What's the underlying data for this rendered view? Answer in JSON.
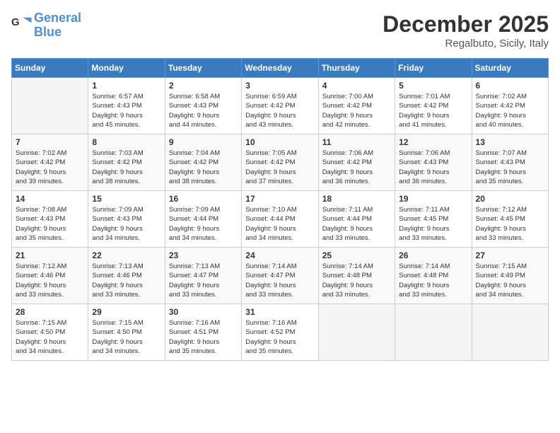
{
  "logo": {
    "line1": "General",
    "line2": "Blue"
  },
  "title": "December 2025",
  "location": "Regalbuto, Sicily, Italy",
  "days_of_week": [
    "Sunday",
    "Monday",
    "Tuesday",
    "Wednesday",
    "Thursday",
    "Friday",
    "Saturday"
  ],
  "weeks": [
    [
      {
        "day": "",
        "info": ""
      },
      {
        "day": "1",
        "info": "Sunrise: 6:57 AM\nSunset: 4:43 PM\nDaylight: 9 hours\nand 45 minutes."
      },
      {
        "day": "2",
        "info": "Sunrise: 6:58 AM\nSunset: 4:43 PM\nDaylight: 9 hours\nand 44 minutes."
      },
      {
        "day": "3",
        "info": "Sunrise: 6:59 AM\nSunset: 4:42 PM\nDaylight: 9 hours\nand 43 minutes."
      },
      {
        "day": "4",
        "info": "Sunrise: 7:00 AM\nSunset: 4:42 PM\nDaylight: 9 hours\nand 42 minutes."
      },
      {
        "day": "5",
        "info": "Sunrise: 7:01 AM\nSunset: 4:42 PM\nDaylight: 9 hours\nand 41 minutes."
      },
      {
        "day": "6",
        "info": "Sunrise: 7:02 AM\nSunset: 4:42 PM\nDaylight: 9 hours\nand 40 minutes."
      }
    ],
    [
      {
        "day": "7",
        "info": "Sunrise: 7:02 AM\nSunset: 4:42 PM\nDaylight: 9 hours\nand 39 minutes."
      },
      {
        "day": "8",
        "info": "Sunrise: 7:03 AM\nSunset: 4:42 PM\nDaylight: 9 hours\nand 38 minutes."
      },
      {
        "day": "9",
        "info": "Sunrise: 7:04 AM\nSunset: 4:42 PM\nDaylight: 9 hours\nand 38 minutes."
      },
      {
        "day": "10",
        "info": "Sunrise: 7:05 AM\nSunset: 4:42 PM\nDaylight: 9 hours\nand 37 minutes."
      },
      {
        "day": "11",
        "info": "Sunrise: 7:06 AM\nSunset: 4:42 PM\nDaylight: 9 hours\nand 36 minutes."
      },
      {
        "day": "12",
        "info": "Sunrise: 7:06 AM\nSunset: 4:43 PM\nDaylight: 9 hours\nand 36 minutes."
      },
      {
        "day": "13",
        "info": "Sunrise: 7:07 AM\nSunset: 4:43 PM\nDaylight: 9 hours\nand 35 minutes."
      }
    ],
    [
      {
        "day": "14",
        "info": "Sunrise: 7:08 AM\nSunset: 4:43 PM\nDaylight: 9 hours\nand 35 minutes."
      },
      {
        "day": "15",
        "info": "Sunrise: 7:09 AM\nSunset: 4:43 PM\nDaylight: 9 hours\nand 34 minutes."
      },
      {
        "day": "16",
        "info": "Sunrise: 7:09 AM\nSunset: 4:44 PM\nDaylight: 9 hours\nand 34 minutes."
      },
      {
        "day": "17",
        "info": "Sunrise: 7:10 AM\nSunset: 4:44 PM\nDaylight: 9 hours\nand 34 minutes."
      },
      {
        "day": "18",
        "info": "Sunrise: 7:11 AM\nSunset: 4:44 PM\nDaylight: 9 hours\nand 33 minutes."
      },
      {
        "day": "19",
        "info": "Sunrise: 7:11 AM\nSunset: 4:45 PM\nDaylight: 9 hours\nand 33 minutes."
      },
      {
        "day": "20",
        "info": "Sunrise: 7:12 AM\nSunset: 4:45 PM\nDaylight: 9 hours\nand 33 minutes."
      }
    ],
    [
      {
        "day": "21",
        "info": "Sunrise: 7:12 AM\nSunset: 4:46 PM\nDaylight: 9 hours\nand 33 minutes."
      },
      {
        "day": "22",
        "info": "Sunrise: 7:13 AM\nSunset: 4:46 PM\nDaylight: 9 hours\nand 33 minutes."
      },
      {
        "day": "23",
        "info": "Sunrise: 7:13 AM\nSunset: 4:47 PM\nDaylight: 9 hours\nand 33 minutes."
      },
      {
        "day": "24",
        "info": "Sunrise: 7:14 AM\nSunset: 4:47 PM\nDaylight: 9 hours\nand 33 minutes."
      },
      {
        "day": "25",
        "info": "Sunrise: 7:14 AM\nSunset: 4:48 PM\nDaylight: 9 hours\nand 33 minutes."
      },
      {
        "day": "26",
        "info": "Sunrise: 7:14 AM\nSunset: 4:48 PM\nDaylight: 9 hours\nand 33 minutes."
      },
      {
        "day": "27",
        "info": "Sunrise: 7:15 AM\nSunset: 4:49 PM\nDaylight: 9 hours\nand 34 minutes."
      }
    ],
    [
      {
        "day": "28",
        "info": "Sunrise: 7:15 AM\nSunset: 4:50 PM\nDaylight: 9 hours\nand 34 minutes."
      },
      {
        "day": "29",
        "info": "Sunrise: 7:15 AM\nSunset: 4:50 PM\nDaylight: 9 hours\nand 34 minutes."
      },
      {
        "day": "30",
        "info": "Sunrise: 7:16 AM\nSunset: 4:51 PM\nDaylight: 9 hours\nand 35 minutes."
      },
      {
        "day": "31",
        "info": "Sunrise: 7:16 AM\nSunset: 4:52 PM\nDaylight: 9 hours\nand 35 minutes."
      },
      {
        "day": "",
        "info": ""
      },
      {
        "day": "",
        "info": ""
      },
      {
        "day": "",
        "info": ""
      }
    ]
  ]
}
